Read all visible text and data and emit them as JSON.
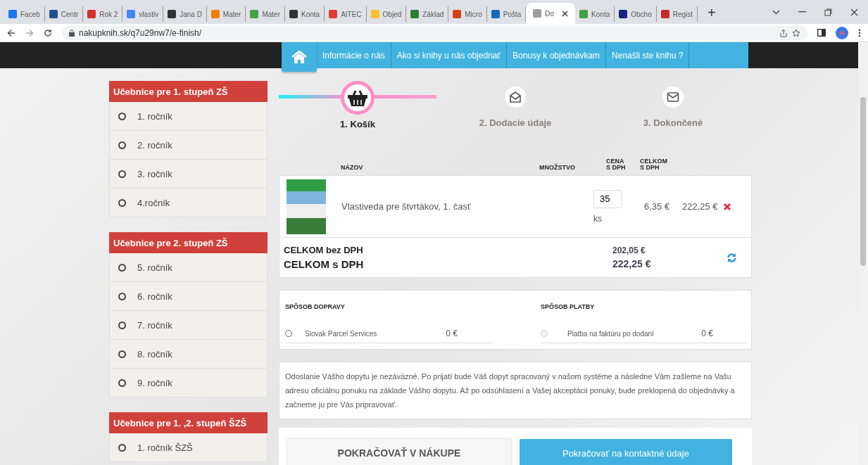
{
  "browser": {
    "tabs": [
      {
        "label": "Faceb",
        "color": "#1877f2",
        "selected": false
      },
      {
        "label": "Centr",
        "color": "#1d4f91",
        "selected": false
      },
      {
        "label": "Rok 2",
        "color": "#d32f2f",
        "selected": false
      },
      {
        "label": "vlastiv",
        "color": "#4285f4",
        "selected": false
      },
      {
        "label": "Jana D",
        "color": "#333333",
        "selected": false
      },
      {
        "label": "Mater",
        "color": "#f57c00",
        "selected": false
      },
      {
        "label": "Mater",
        "color": "#43a047",
        "selected": false
      },
      {
        "label": "Konta",
        "color": "#333333",
        "selected": false
      },
      {
        "label": "AITEC",
        "color": "#e53935",
        "selected": false
      },
      {
        "label": "Objed",
        "color": "#fbc02d",
        "selected": false
      },
      {
        "label": "Základ",
        "color": "#2e7d32",
        "selected": false
      },
      {
        "label": "Micro",
        "color": "#d84315",
        "selected": false
      },
      {
        "label": "Pošta",
        "color": "#0f6cbd",
        "selected": false
      },
      {
        "label": "Do",
        "color": "#9e9e9e",
        "selected": true
      },
      {
        "label": "Konta",
        "color": "#43a047",
        "selected": false
      },
      {
        "label": "Obcho",
        "color": "#1a237e",
        "selected": false
      },
      {
        "label": "Regist",
        "color": "#c62828",
        "selected": false
      }
    ],
    "new_tab": "+",
    "url": "nakupknih.sk/q7u29nw7/e-finish/"
  },
  "nav": {
    "items": [
      "Informácie o nás",
      "Ako si knihy u nás objednať",
      "Bonusy k objednávkam",
      "Nenašli ste knihu ?"
    ]
  },
  "sidebar": {
    "sections": [
      {
        "title": "Učebnice pre 1. stupeň ZŠ",
        "items": [
          "1. ročník",
          "2. ročník",
          "3. ročník",
          "4.ročník"
        ]
      },
      {
        "title": "Učebnice pre 2. stupeň ZŠ",
        "items": [
          "5. ročník",
          "6. ročník",
          "7. ročník",
          "8. ročník",
          "9. ročník"
        ]
      },
      {
        "title": "Učebnice pre 1. ,2. stupeň ŠZŠ",
        "items": [
          "1. ročník ŠZŠ"
        ]
      }
    ]
  },
  "steps": [
    {
      "label": "1. Košík",
      "kind": "basket",
      "selected": true
    },
    {
      "label": "2. Dodacie údaje",
      "kind": "envelope-open",
      "selected": false
    },
    {
      "label": "3. Dokončené",
      "kind": "envelope",
      "selected": false
    }
  ],
  "cart": {
    "columns": [
      "NÁZOV",
      "MNOŽSTVO",
      "CENA\nS DPH",
      "CELKOM\nS DPH"
    ],
    "items": [
      {
        "name": "Vlastiveda pre štvrtákov, 1. časť",
        "quantity": "35",
        "unit": "ks",
        "price": "6,35 €",
        "total": "222,25 €"
      }
    ],
    "total_without_vat_label": "CELKOM bez DPH",
    "total_without_vat": "202,05 €",
    "total_with_vat_label": "CELKOM s DPH",
    "total_with_vat": "222,25 €"
  },
  "delivery": {
    "title": "SPÔSOB DOPRAVY",
    "options": [
      {
        "label": "Slovak Parcel Services",
        "price": "0 €",
        "selected": false,
        "disabled": false
      }
    ]
  },
  "payment": {
    "title": "SPÔSOB PLATBY",
    "options": [
      {
        "label": "Platba na faktúru po dodaní",
        "price": "0 €",
        "selected": false,
        "disabled": true
      }
    ]
  },
  "notice": "Odoslanie Vášho dopytu je nezáväzné. Po prijatí bude Váš dopyt spracovaný v našom systéme a následne Vám zašleme na Vašu adresu oficiálnu ponuku na základe Vášho dopytu. Až po odsúhlasení a Vašej akceptácii ponuky, bude preklopená do objednávky a začneme ju pre Vás pripravovať.",
  "buttons": {
    "continue_shopping": "POKRAČOVAŤ V NÁKUPE",
    "continue_contact": "Pokračovať na kontaktné údaje"
  }
}
